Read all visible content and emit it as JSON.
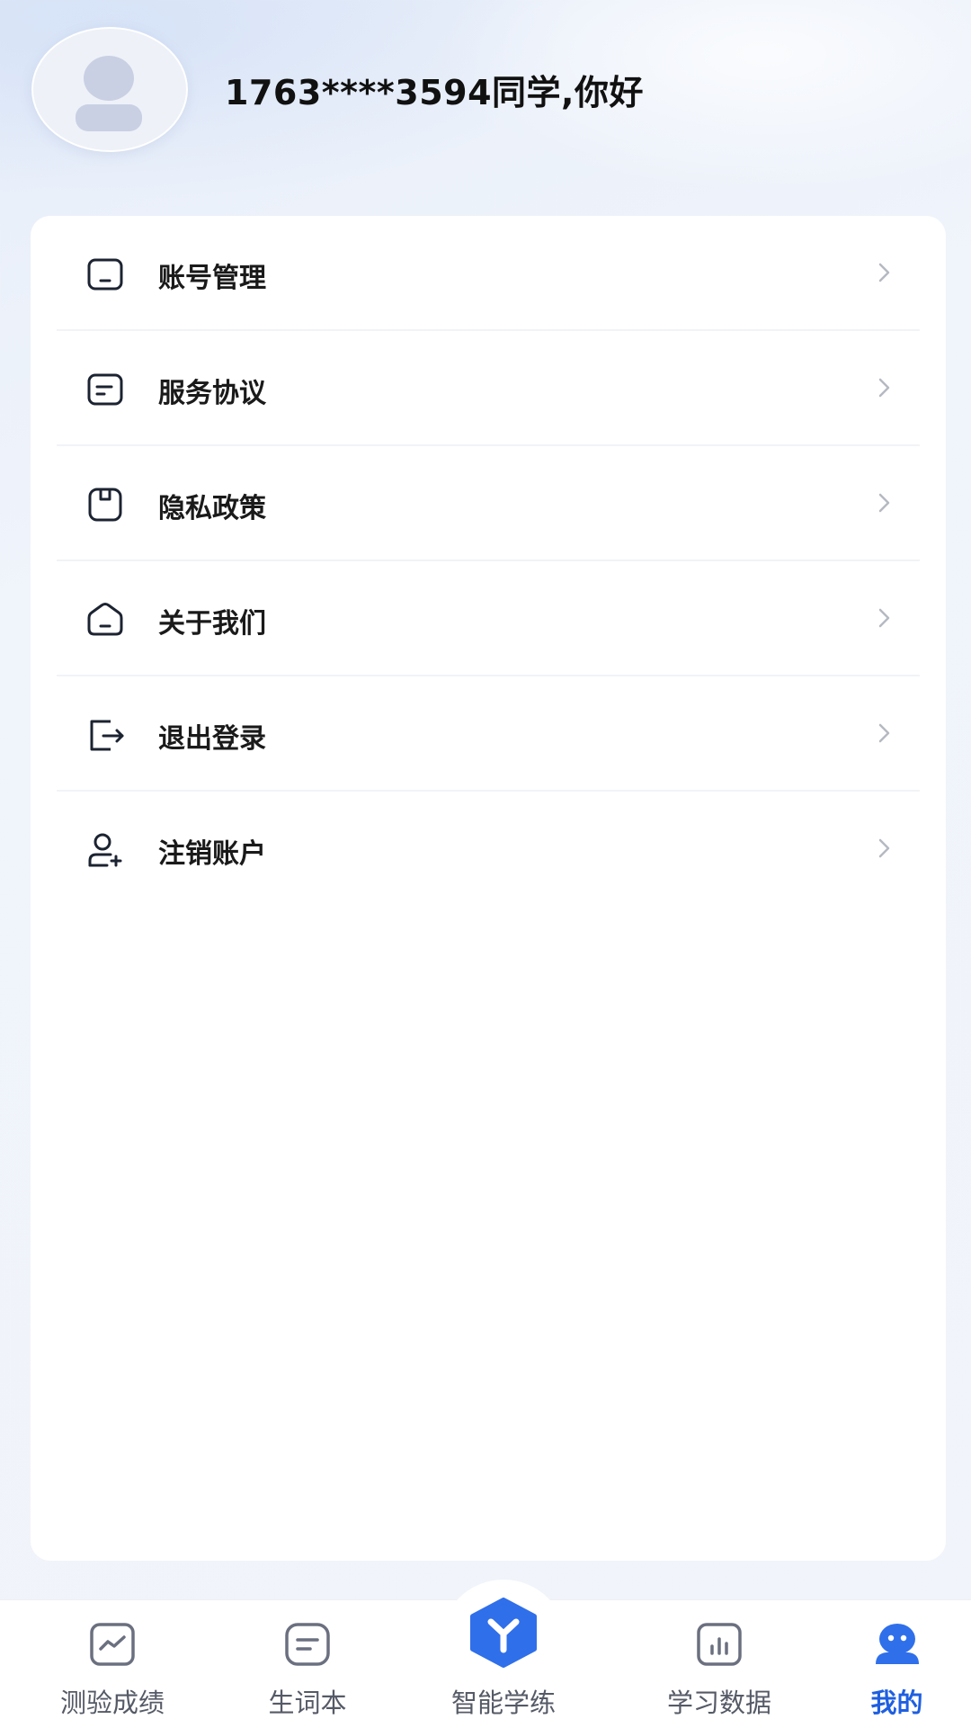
{
  "header": {
    "greeting": "1763****3594同学,你好"
  },
  "menu": {
    "items": [
      {
        "label": "账号管理",
        "icon": "account-card-icon"
      },
      {
        "label": "服务协议",
        "icon": "document-icon"
      },
      {
        "label": "隐私政策",
        "icon": "lock-folder-icon"
      },
      {
        "label": "关于我们",
        "icon": "home-icon"
      },
      {
        "label": "退出登录",
        "icon": "logout-icon"
      },
      {
        "label": "注销账户",
        "icon": "user-remove-icon"
      }
    ]
  },
  "tabbar": {
    "tabs": [
      {
        "label": "测验成绩",
        "icon": "chart-line-icon",
        "active": false
      },
      {
        "label": "生词本",
        "icon": "notebook-icon",
        "active": false
      },
      {
        "label": "智能学练",
        "icon": "smart-practice-icon",
        "active": false
      },
      {
        "label": "学习数据",
        "icon": "bar-chart-icon",
        "active": false
      },
      {
        "label": "我的",
        "icon": "profile-icon",
        "active": true
      }
    ]
  },
  "colors": {
    "accent": "#1f5fe0",
    "text": "#1a1a1a",
    "tab_inactive": "#555a66"
  }
}
